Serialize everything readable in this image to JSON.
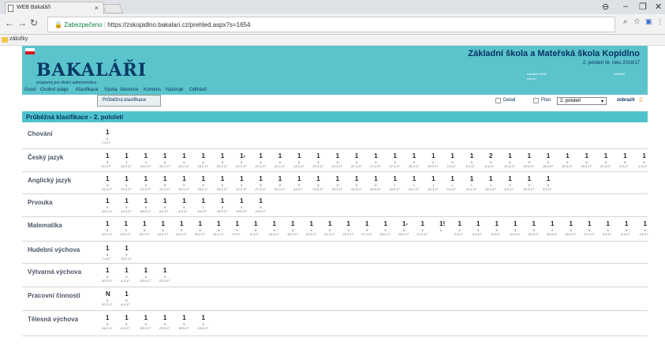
{
  "browser": {
    "tab_title": "WEB Bakaláři",
    "secure": "Zabezpečeno",
    "url": "https://zskopidlno.bakalari.cz/prehled.aspx?s=1654",
    "bookmark": "záložky"
  },
  "header": {
    "logo": "BAKALÁŘI",
    "slogan": "programy pro školní administrativu",
    "school": "Základní škola a Mateřská škola Kopidlno",
    "period": "2. pololetí šk. roku 2016/17",
    "user_label": "uživatel: rodič",
    "role_label": "jméno:",
    "logout": "odhlásit"
  },
  "menu": [
    "Úvod",
    "Osobní údaje",
    "Klasifikace",
    "Výuka",
    "Absence",
    "Komens",
    "Nástroje",
    "Odhlásit"
  ],
  "submenu": "Průběžná klasifikace",
  "controls": {
    "detail": "Detail",
    "plan": "Plán",
    "select": "2. pololetí",
    "show": "zobrazit"
  },
  "page_title": "Průběžná klasifikace - 2. pololetí",
  "subjects": [
    {
      "name": "Chování",
      "grades": [
        [
          "1",
          "5",
          "7.4.17"
        ]
      ]
    },
    {
      "name": "Český jazyk",
      "grades": [
        [
          "1",
          "5",
          "9.2.17"
        ],
        [
          "1",
          "2",
          "10.2.17"
        ],
        [
          "1",
          "4",
          "14.2.17"
        ],
        [
          "1",
          "5",
          "15.2.17"
        ],
        [
          "1",
          "5",
          "15.2.17"
        ],
        [
          "1",
          "5",
          "16.2.17"
        ],
        [
          "1",
          "5",
          "20.2.17"
        ],
        [
          "1-",
          "5",
          "21.2.17"
        ],
        [
          "1",
          "6",
          "21.2.17"
        ],
        [
          "1",
          "5",
          "22.2.17"
        ],
        [
          "1",
          "5",
          "13.3.17"
        ],
        [
          "1",
          "5",
          "15.3.17"
        ],
        [
          "1",
          "5",
          "21.3.17"
        ],
        [
          "1",
          "5",
          "22.3.17"
        ],
        [
          "1",
          "5",
          "27.3.17"
        ],
        [
          "1",
          "3",
          "27.3.17"
        ],
        [
          "1",
          "5",
          "28.3.17"
        ],
        [
          "1",
          "2",
          "30.3.17"
        ],
        [
          "1",
          "5",
          "3.4.17"
        ],
        [
          "1",
          "5",
          "5.4.17"
        ],
        [
          "2",
          "5",
          "6.4.17"
        ],
        [
          "1",
          "5",
          "10.4.17"
        ],
        [
          "1",
          "5",
          "18.4.17"
        ],
        [
          "1",
          "5",
          "18.4.17"
        ],
        [
          "1",
          "5",
          "20.4.17"
        ],
        [
          "1",
          "5",
          "25.4.17"
        ],
        [
          "1",
          "5",
          "27.4.17"
        ],
        [
          "1",
          "5",
          "3.5.17"
        ],
        [
          "1",
          "5",
          "4.5.17"
        ]
      ]
    },
    {
      "name": "Anglický jazyk",
      "grades": [
        [
          "1",
          "U",
          "21.4.17"
        ],
        [
          "1",
          "5",
          "22.3.17"
        ],
        [
          "1",
          "3",
          "13.3.17"
        ],
        [
          "1",
          "5",
          "13.3.17"
        ],
        [
          "1",
          "5",
          "20.3.17"
        ],
        [
          "1",
          "5",
          "15.2.17"
        ],
        [
          "1",
          "5",
          "20.2.17"
        ],
        [
          "1",
          "5",
          "22.2.17"
        ],
        [
          "1",
          "5",
          "27.3.17"
        ],
        [
          "1",
          "5",
          "31.3.17"
        ],
        [
          "1",
          "5",
          "4.5.17"
        ],
        [
          "1",
          "8",
          "24.5.17"
        ],
        [
          "1",
          "5",
          "28.3.17"
        ],
        [
          "1",
          "5",
          "14.8.17"
        ],
        [
          "1",
          "5",
          "10.4.17"
        ],
        [
          "1",
          "1",
          "18.5.17"
        ],
        [
          "1",
          "1",
          "15.2.17"
        ],
        [
          "1",
          "1",
          "16.3.17"
        ],
        [
          "1",
          "1",
          "3.4.17"
        ],
        [
          "1",
          "1",
          "12.4.17"
        ],
        [
          "1",
          "1",
          "18.4.17"
        ],
        [
          "1",
          "3",
          "5.6.17"
        ],
        [
          "1",
          "3",
          "20.3.17"
        ],
        [
          "1",
          "5",
          "3.5.17"
        ]
      ]
    },
    {
      "name": "Prvouka",
      "grades": [
        [
          "1",
          "5",
          "15.2.17"
        ],
        [
          "1",
          "5",
          "14.3.17"
        ],
        [
          "1",
          "5",
          "29.3.17"
        ],
        [
          "1",
          "5",
          "6.4.17"
        ],
        [
          "1",
          "5",
          "4.5.17"
        ],
        [
          "1",
          "2",
          "8.5.17"
        ],
        [
          "1",
          "5",
          "18.5.17"
        ],
        [
          "1",
          "5",
          "16.5.17"
        ],
        [
          "1",
          "5",
          "23.5.17"
        ]
      ]
    },
    {
      "name": "Matematika",
      "grades": [
        [
          "1",
          "5",
          "15.2.17"
        ],
        [
          "1",
          "5",
          "15.2.17"
        ],
        [
          "1",
          "5",
          "15.2.17"
        ],
        [
          "1",
          "5",
          "16.2.17"
        ],
        [
          "1",
          "5",
          "16.2.17"
        ],
        [
          "1",
          "5",
          "20.2.17"
        ],
        [
          "1",
          "5",
          "21.2.17"
        ],
        [
          "1",
          "5",
          "7.3.17"
        ],
        [
          "1",
          "5",
          "8.3.17"
        ],
        [
          "1",
          "5",
          "14.3.17"
        ],
        [
          "1",
          "5",
          "15.3.17"
        ],
        [
          "1",
          "5",
          "15.3.17"
        ],
        [
          "1",
          "5",
          "21.3.17"
        ],
        [
          "1",
          "5",
          "22.3.17"
        ],
        [
          "1",
          "5",
          "27.3.17"
        ],
        [
          "1",
          "5",
          "29.3.17"
        ],
        [
          "1-",
          "5",
          "28.3.17"
        ],
        [
          "1",
          "5",
          "27.3.17"
        ],
        [
          "1!",
          "5",
          ""
        ],
        [
          "1",
          "5",
          "3.4.17"
        ],
        [
          "1",
          "5",
          "5.4.17"
        ],
        [
          "1",
          "5",
          "6.4.17"
        ],
        [
          "1",
          "5",
          "10.4.17"
        ],
        [
          "1",
          "5",
          "20.4.17"
        ],
        [
          "1",
          "2",
          "20.4.17"
        ],
        [
          "1",
          "5",
          "26.4.17"
        ],
        [
          "1",
          "5",
          "27.4.17"
        ],
        [
          "1",
          "5",
          "3.5.17"
        ],
        [
          "1",
          "5",
          "4.5.17"
        ],
        [
          "1",
          "5",
          "4.5.17"
        ]
      ]
    },
    {
      "name": "Hudební výchova",
      "grades": [
        [
          "1",
          "5",
          "7.4.17"
        ],
        [
          "1",
          "5",
          "24.3.17"
        ]
      ]
    },
    {
      "name": "Výtvarná výchova",
      "grades": [
        [
          "1",
          "5",
          "20.3.17"
        ],
        [
          "1",
          "5",
          "4.4.17"
        ],
        [
          "1",
          "5",
          "28.4.17"
        ],
        [
          "1",
          "2",
          "22.5.17"
        ]
      ]
    },
    {
      "name": "Pracovní činnosti",
      "grades": [
        [
          "N",
          "5",
          "20.2.17"
        ],
        [
          "1",
          "5",
          "4.4.17"
        ]
      ]
    },
    {
      "name": "Tělesná výchova",
      "grades": [
        [
          "1",
          "5",
          "14.2.17"
        ],
        [
          "1",
          "5",
          "6.4.17"
        ],
        [
          "1",
          "5",
          "28.3.17"
        ],
        [
          "1",
          "5",
          "23.5.17"
        ],
        [
          "1",
          "5",
          "18.5.17"
        ],
        [
          "1",
          "5",
          "13.6.17"
        ]
      ]
    }
  ],
  "colors": {
    "header": "#5bc3cc",
    "titlebar": "#4fc3cc",
    "logo": "#0a3a66"
  }
}
